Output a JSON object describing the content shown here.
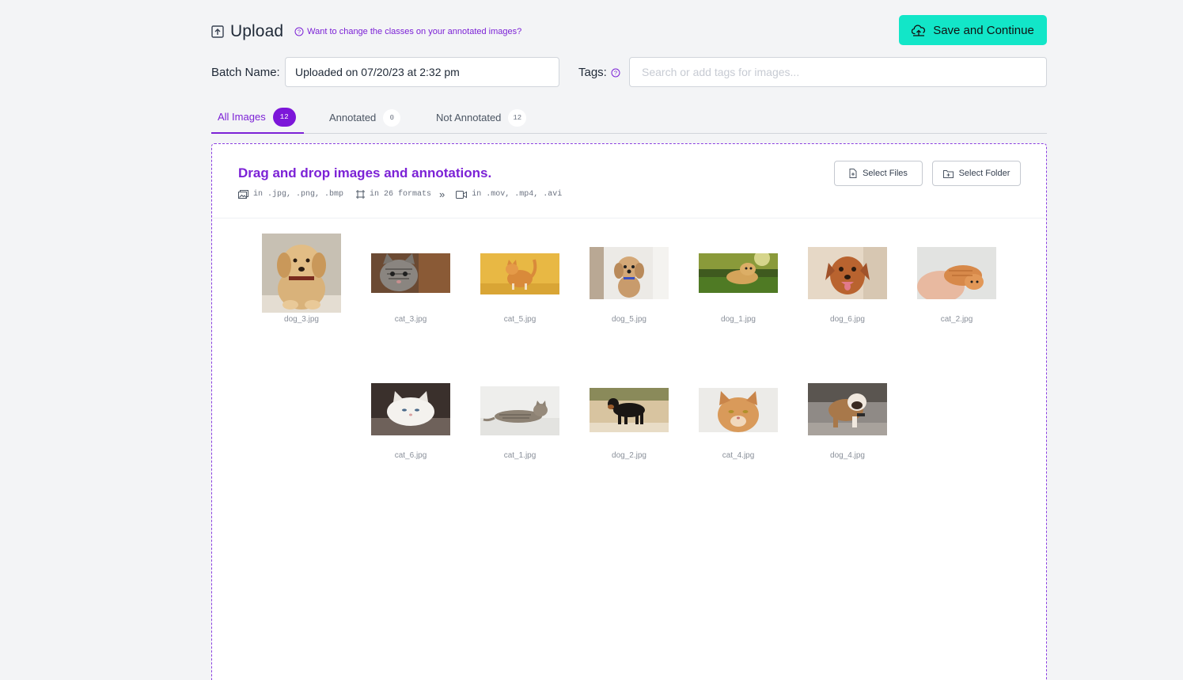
{
  "header": {
    "title": "Upload",
    "help_link": "Want to change the classes on your annotated images?",
    "save_button": "Save and Continue"
  },
  "batch": {
    "label": "Batch Name:",
    "value": "Uploaded on 07/20/23 at 2:32 pm",
    "tags_label": "Tags:",
    "tags_placeholder": "Search or add tags for images..."
  },
  "tabs": [
    {
      "label": "All Images",
      "count": "12",
      "active": true
    },
    {
      "label": "Annotated",
      "count": "0",
      "active": false
    },
    {
      "label": "Not Annotated",
      "count": "12",
      "active": false
    }
  ],
  "dropzone": {
    "title": "Drag and drop images and annotations.",
    "formats": {
      "images": "in .jpg, .png, .bmp",
      "annotations": "in 26 formats",
      "chevron": "»",
      "videos": "in .mov, .mp4, .avi"
    },
    "select_files": "Select Files",
    "select_folder": "Select Folder"
  },
  "images": [
    {
      "name": "dog_3.jpg",
      "icon": "golden-puppy-photo"
    },
    {
      "name": "cat_3.jpg",
      "icon": "tabby-kitten-photo"
    },
    {
      "name": "cat_5.jpg",
      "icon": "orange-cat-yellow-bg-photo"
    },
    {
      "name": "dog_5.jpg",
      "icon": "curly-dog-photo"
    },
    {
      "name": "dog_1.jpg",
      "icon": "golden-retriever-grass-photo"
    },
    {
      "name": "dog_6.jpg",
      "icon": "brown-dog-smiling-photo"
    },
    {
      "name": "cat_2.jpg",
      "icon": "ginger-cat-lying-photo"
    },
    {
      "name": "cat_6.jpg",
      "icon": "white-persian-cat-photo"
    },
    {
      "name": "cat_1.jpg",
      "icon": "tabby-cat-lying-photo"
    },
    {
      "name": "dog_2.jpg",
      "icon": "rottweiler-photo"
    },
    {
      "name": "cat_4.jpg",
      "icon": "orange-cat-face-photo"
    },
    {
      "name": "dog_4.jpg",
      "icon": "bulldog-photo"
    }
  ],
  "colors": {
    "accent": "#7c22d6",
    "save_button": "#12e6c8",
    "background": "#f3f4f6"
  }
}
